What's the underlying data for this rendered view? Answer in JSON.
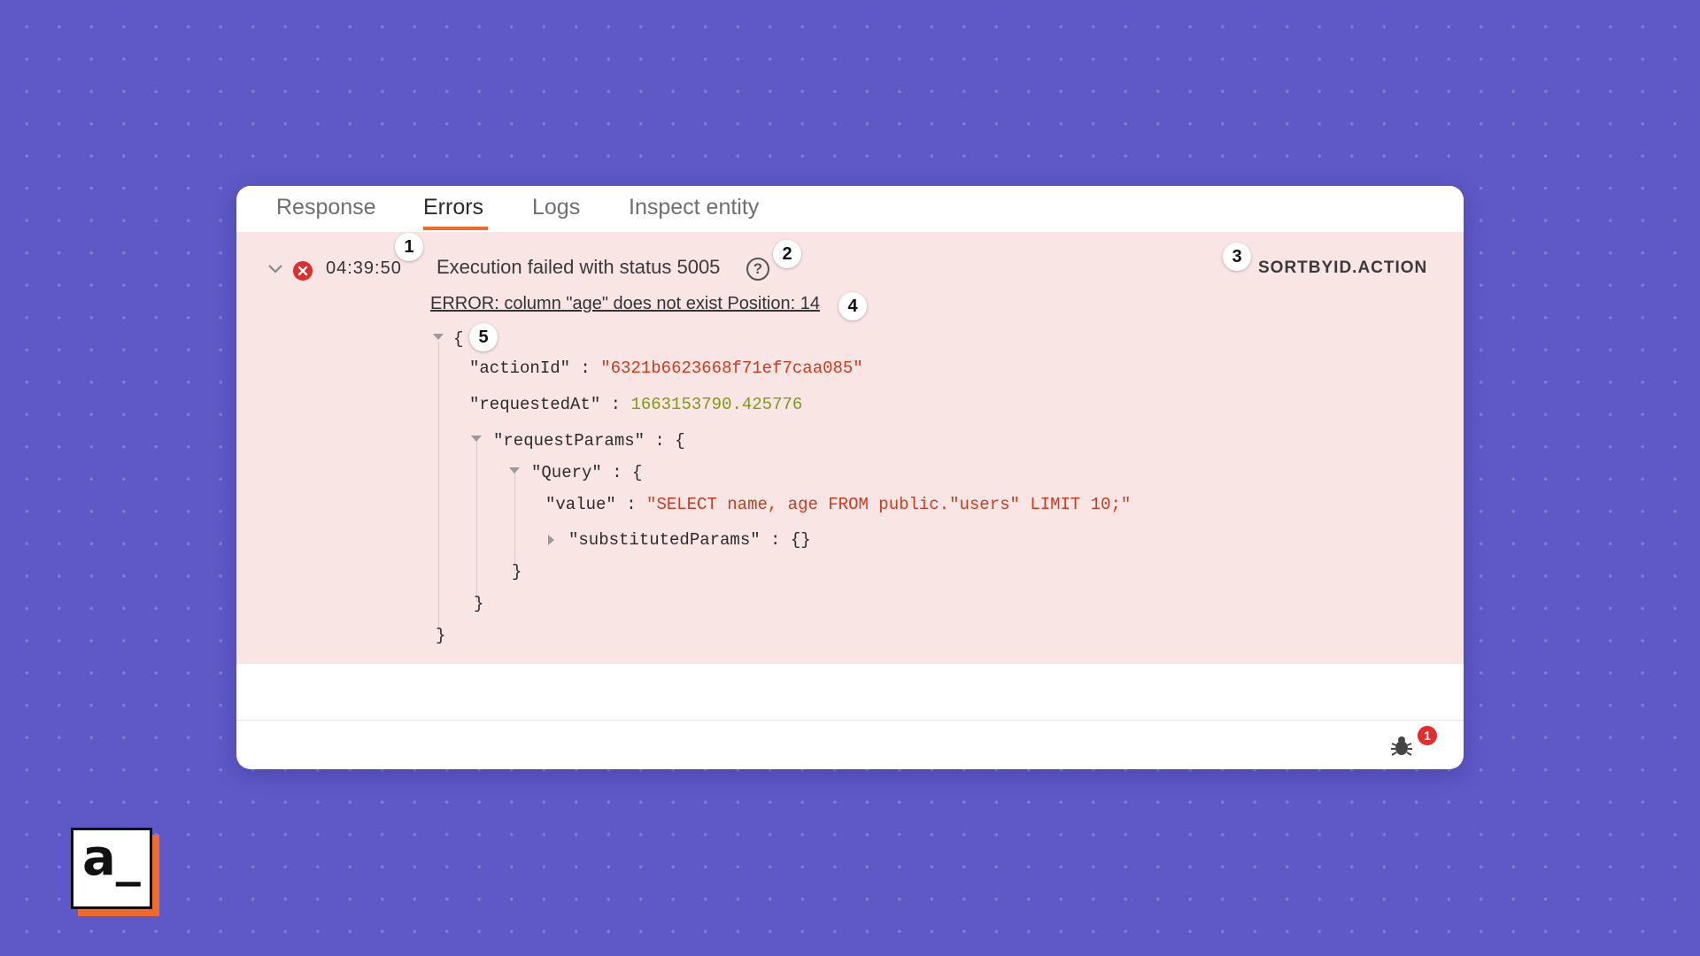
{
  "tabs": [
    {
      "label": "Response"
    },
    {
      "label": "Errors",
      "active": true
    },
    {
      "label": "Logs"
    },
    {
      "label": "Inspect entity"
    }
  ],
  "error": {
    "timestamp": "04:39:50",
    "message": "Execution failed with status 5005",
    "help_icon": "?",
    "entity": "SORTBYID.ACTION",
    "detail_link": "ERROR: column \"age\" does not exist Position: 14"
  },
  "annotations": [
    "1",
    "2",
    "3",
    "4",
    "5"
  ],
  "json_view": {
    "open_brace": "{",
    "close_brace": "}",
    "actionId_key": "\"actionId\"",
    "actionId_value": "\"6321b6623668f71ef7caa085\"",
    "requestedAt_key": "\"requestedAt\"",
    "requestedAt_value": "1663153790.425776",
    "requestParams_key": "\"requestParams\"",
    "query_key": "\"Query\"",
    "value_key": "\"value\"",
    "value_value": "\"SELECT name, age FROM public.\"users\" LIMIT 10;\"",
    "substitutedParams_key": "\"substitutedParams\"",
    "substitutedParams_value": "{}",
    "colon": " : ",
    "colon_brace": " : {"
  },
  "footer": {
    "bug_icon": "bug-icon",
    "notification_count": "1"
  },
  "logo": {
    "text": "a_"
  },
  "colors": {
    "background": "#5f59c8",
    "accent": "#f26a2a",
    "error_bg": "#f8e5e4",
    "error_red": "#e02e2e",
    "string_red": "#d13a1c",
    "number_green": "#7d9a1a"
  }
}
